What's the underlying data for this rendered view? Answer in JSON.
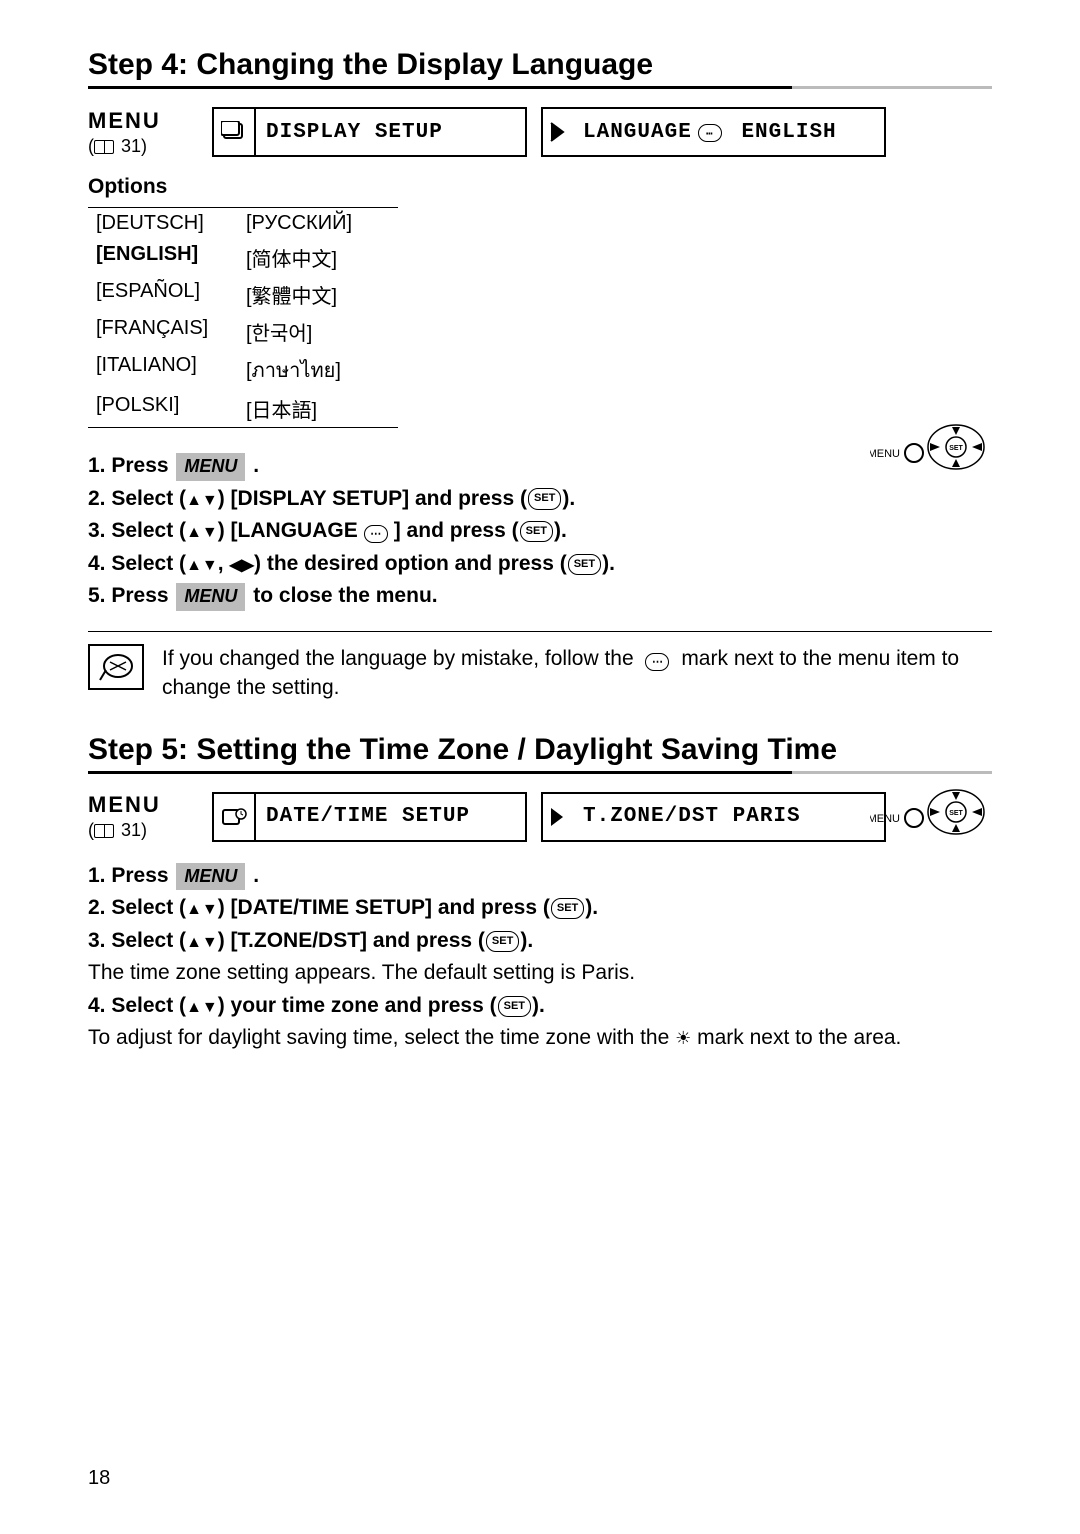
{
  "step4": {
    "title": "Step 4: Changing the Display Language",
    "menu_label": "MENU",
    "menu_ref": "31",
    "box1": "DISPLAY SETUP",
    "box2_label": "LANGUAGE",
    "box2_value": "ENGLISH",
    "options_label": "Options",
    "options": {
      "col1": [
        "[DEUTSCH]",
        "[ENGLISH]",
        "[ESPAÑOL]",
        "[FRANÇAIS]",
        "[ITALIANO]",
        "[POLSKI]"
      ],
      "col2": [
        "[РУССКИЙ]",
        "[简体中文]",
        "[繁體中文]",
        "[한국어]",
        "[ภาษาไทย]",
        "[日本語]"
      ]
    },
    "instructions": {
      "i1_a": "1.  Press ",
      "i1_b": " .",
      "i2_a": "2.  Select (",
      "i2_b": ") [DISPLAY SETUP] and press (",
      "i2_c": ").",
      "i3_a": "3.  Select (",
      "i3_b": ") [LANGUAGE",
      "i3_c": "] and press (",
      "i3_d": ").",
      "i4_a": "4.  Select (",
      "i4_b": ", ",
      "i4_c": ") the desired option and press (",
      "i4_d": ").",
      "i5_a": "5.  Press ",
      "i5_b": "  to close the menu."
    },
    "note_a": "If you changed the language by mistake, follow the ",
    "note_b": " mark next to the menu item to change the setting."
  },
  "step5": {
    "title": "Step 5: Setting the Time Zone / Daylight Saving Time",
    "menu_label": "MENU",
    "menu_ref": "31",
    "box1": "DATE/TIME SETUP",
    "box2": "T.ZONE/DST PARIS",
    "instructions": {
      "i1_a": "1.  Press ",
      "i1_b": " .",
      "i2_a": "2.  Select (",
      "i2_b": ") [DATE/TIME SETUP] and press (",
      "i2_c": ").",
      "i3_a": "3.  Select (",
      "i3_b": ") [T.ZONE/DST] and press (",
      "i3_c": ").",
      "i3_note": "The time zone setting appears. The default setting is Paris.",
      "i4_a": "4.  Select (",
      "i4_b": ") your time zone and press (",
      "i4_c": ").",
      "i4_note_a": "To adjust for daylight saving time, select the time zone with the ",
      "i4_note_b": " mark next to the area."
    }
  },
  "labels": {
    "menu_pill": "MENU",
    "set": "SET",
    "lang_icon": "⋯",
    "menu_small": "MENU"
  },
  "page_number": "18"
}
